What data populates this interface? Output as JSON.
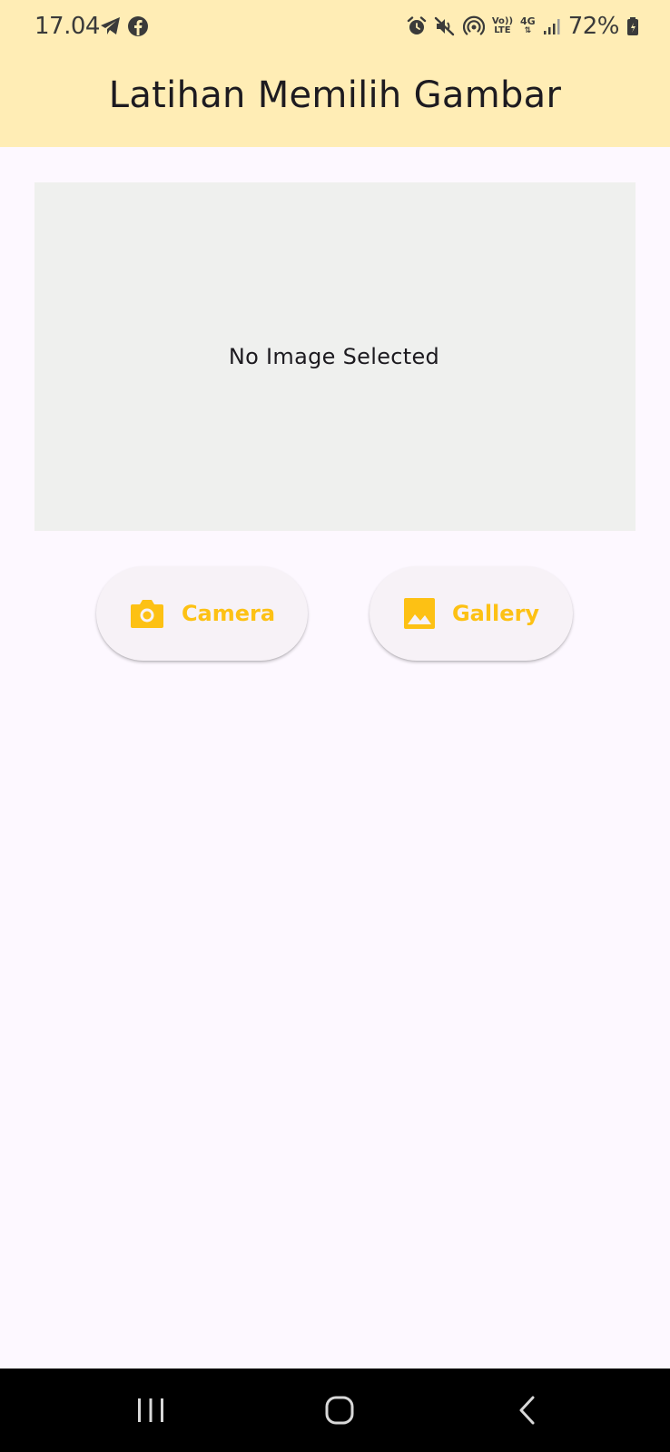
{
  "status_bar": {
    "time": "17.04",
    "battery": "72%",
    "icons_left": [
      "telegram-icon",
      "facebook-icon"
    ],
    "icons_right": [
      "alarm-icon",
      "mute-icon",
      "hotspot-icon",
      "volte-icon",
      "4g-icon",
      "signal-icon",
      "battery-icon"
    ],
    "volte_text_top": "Vo))",
    "volte_text_bottom": "LTE",
    "network_text": "4G"
  },
  "app_bar": {
    "title": "Latihan Memilih Gambar"
  },
  "image_preview": {
    "placeholder": "No Image Selected"
  },
  "buttons": {
    "camera": {
      "label": "Camera",
      "icon": "camera-icon"
    },
    "gallery": {
      "label": "Gallery",
      "icon": "image-icon"
    }
  },
  "nav_bar": {
    "items": [
      "recent-apps-icon",
      "home-icon",
      "back-icon"
    ]
  },
  "colors": {
    "app_bar_bg": "#ffedb5",
    "page_bg": "#fdf8ff",
    "accent": "#fdc114",
    "image_box_bg": "#eff0ee",
    "nav_bg": "#000000"
  }
}
